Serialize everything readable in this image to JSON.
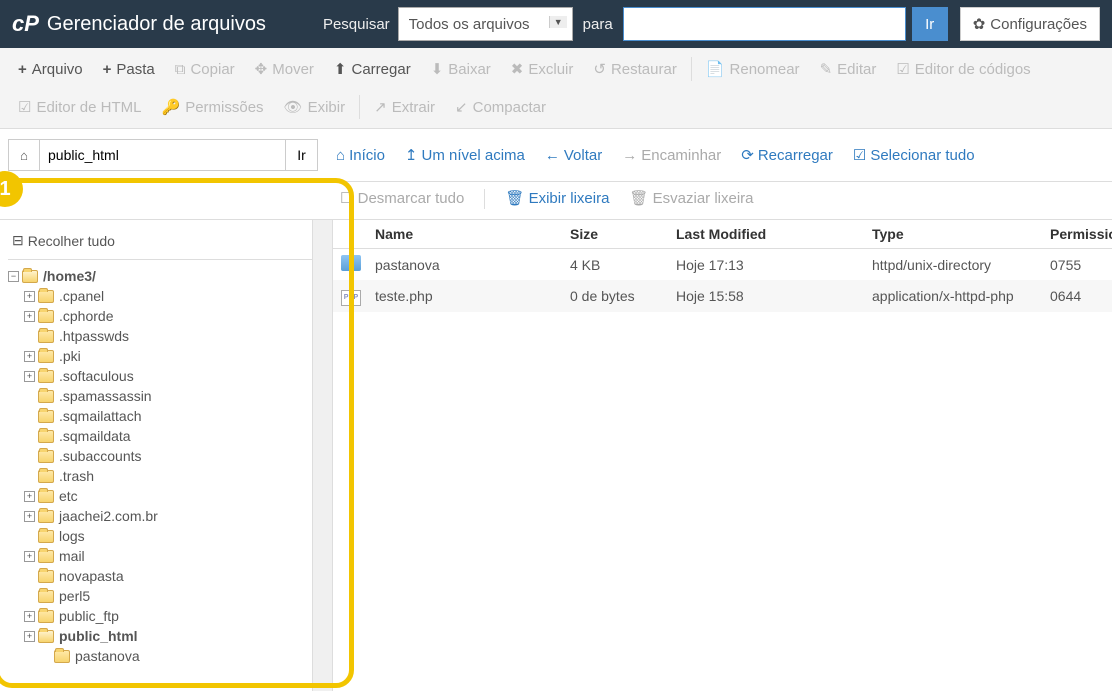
{
  "header": {
    "app_title": "Gerenciador de arquivos",
    "search_label": "Pesquisar",
    "search_scope": "Todos os arquivos",
    "para_label": "para",
    "go_btn": "Ir",
    "config_btn": "Configurações"
  },
  "toolbar": {
    "arquivo": "Arquivo",
    "pasta": "Pasta",
    "copiar": "Copiar",
    "mover": "Mover",
    "carregar": "Carregar",
    "baixar": "Baixar",
    "excluir": "Excluir",
    "restaurar": "Restaurar",
    "renomear": "Renomear",
    "editar": "Editar",
    "editor_codigos": "Editor de códigos",
    "editor_html": "Editor de HTML",
    "permissoes": "Permissões",
    "exibir": "Exibir",
    "extrair": "Extrair",
    "compactar": "Compactar"
  },
  "pathbar": {
    "path": "public_html",
    "go": "Ir",
    "inicio": "Início",
    "nivel_acima": "Um nível acima",
    "voltar": "Voltar",
    "encaminhar": "Encaminhar",
    "recarregar": "Recarregar",
    "selecionar_tudo": "Selecionar tudo"
  },
  "secnav": {
    "desmarcar": "Desmarcar tudo",
    "exibir_lixeira": "Exibir lixeira",
    "esvaziar": "Esvaziar lixeira"
  },
  "sidebar": {
    "collapse_all": "Recolher tudo",
    "root": "/home3/",
    "items": [
      {
        "name": ".cpanel",
        "exp": true
      },
      {
        "name": ".cphorde",
        "exp": true
      },
      {
        "name": ".htpasswds",
        "exp": false
      },
      {
        "name": ".pki",
        "exp": true
      },
      {
        "name": ".softaculous",
        "exp": true
      },
      {
        "name": ".spamassassin",
        "exp": false
      },
      {
        "name": ".sqmailattach",
        "exp": false
      },
      {
        "name": ".sqmaildata",
        "exp": false
      },
      {
        "name": ".subaccounts",
        "exp": false
      },
      {
        "name": ".trash",
        "exp": false
      },
      {
        "name": "etc",
        "exp": true
      },
      {
        "name": "jaachei2.com.br",
        "exp": true
      },
      {
        "name": "logs",
        "exp": false
      },
      {
        "name": "mail",
        "exp": true
      },
      {
        "name": "novapasta",
        "exp": false
      },
      {
        "name": "perl5",
        "exp": false
      },
      {
        "name": "public_ftp",
        "exp": true
      },
      {
        "name": "public_html",
        "exp": true,
        "bold": true,
        "open": true
      }
    ],
    "child": "pastanova"
  },
  "table": {
    "headers": {
      "name": "Name",
      "size": "Size",
      "mod": "Last Modified",
      "type": "Type",
      "perm": "Permissions"
    },
    "rows": [
      {
        "icon": "folder",
        "name": "pastanova",
        "size": "4 KB",
        "mod": "Hoje 17:13",
        "type": "httpd/unix-directory",
        "perm": "0755"
      },
      {
        "icon": "php",
        "name": "teste.php",
        "size": "0 de bytes",
        "mod": "Hoje 15:58",
        "type": "application/x-httpd-php",
        "perm": "0644"
      }
    ]
  },
  "annotation": {
    "badge": "1"
  }
}
